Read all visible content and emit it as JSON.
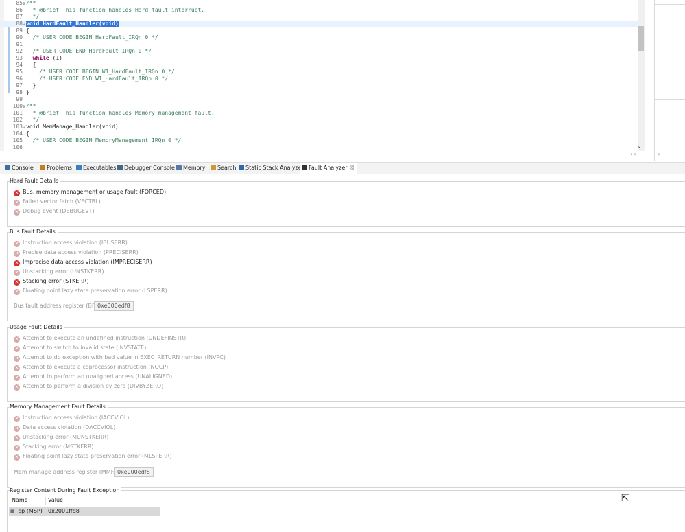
{
  "editor": {
    "lines": [
      {
        "n": "85",
        "fold": "⊖",
        "parts": [
          {
            "t": "/**",
            "c": "cmt"
          }
        ]
      },
      {
        "n": "86",
        "fold": "",
        "parts": [
          {
            "t": "  * @brief This function handles Hard fault interrupt.",
            "c": "cmt"
          }
        ]
      },
      {
        "n": "87",
        "fold": "",
        "parts": [
          {
            "t": "  */",
            "c": "cmt"
          }
        ]
      },
      {
        "n": "88",
        "fold": "⊖",
        "cur": true,
        "parts": [
          {
            "t": "void HardFault_Handler(void)",
            "c": "sel"
          }
        ]
      },
      {
        "n": "89",
        "fold": "",
        "parts": [
          {
            "t": "{",
            "c": "code"
          }
        ]
      },
      {
        "n": "90",
        "fold": "",
        "parts": [
          {
            "t": "  /* USER CODE BEGIN HardFault_IRQn 0 */",
            "c": "cmt"
          }
        ]
      },
      {
        "n": "91",
        "fold": "",
        "parts": [
          {
            "t": "",
            "c": "code"
          }
        ]
      },
      {
        "n": "92",
        "fold": "",
        "parts": [
          {
            "t": "  /* USER CODE END HardFault_IRQn 0 */",
            "c": "cmt"
          }
        ]
      },
      {
        "n": "93",
        "fold": "",
        "parts": [
          {
            "t": "  ",
            "c": "code"
          },
          {
            "t": "while",
            "c": "kw"
          },
          {
            "t": " (1)",
            "c": "code"
          }
        ]
      },
      {
        "n": "94",
        "fold": "",
        "parts": [
          {
            "t": "  {",
            "c": "code"
          }
        ]
      },
      {
        "n": "95",
        "fold": "",
        "parts": [
          {
            "t": "    /* USER CODE BEGIN W1_HardFault_IRQn 0 */",
            "c": "cmt"
          }
        ]
      },
      {
        "n": "96",
        "fold": "",
        "parts": [
          {
            "t": "    /* USER CODE END W1_HardFault_IRQn 0 */",
            "c": "cmt"
          }
        ]
      },
      {
        "n": "97",
        "fold": "",
        "parts": [
          {
            "t": "  }",
            "c": "code"
          }
        ]
      },
      {
        "n": "98",
        "fold": "",
        "parts": [
          {
            "t": "}",
            "c": "code"
          }
        ]
      },
      {
        "n": "99",
        "fold": "",
        "parts": [
          {
            "t": "",
            "c": "code"
          }
        ]
      },
      {
        "n": "100",
        "fold": "⊖",
        "parts": [
          {
            "t": "/**",
            "c": "cmt"
          }
        ]
      },
      {
        "n": "101",
        "fold": "",
        "parts": [
          {
            "t": "  * @brief This function handles Memory management fault.",
            "c": "cmt"
          }
        ]
      },
      {
        "n": "102",
        "fold": "",
        "parts": [
          {
            "t": "  */",
            "c": "cmt"
          }
        ]
      },
      {
        "n": "103",
        "fold": "⊖",
        "parts": [
          {
            "t": "void MemManage_Handler(void)",
            "c": "code"
          }
        ]
      },
      {
        "n": "104",
        "fold": "",
        "parts": [
          {
            "t": "{",
            "c": "code"
          }
        ]
      },
      {
        "n": "105",
        "fold": "",
        "parts": [
          {
            "t": "  /* USER CODE BEGIN MemoryManagement_IRQn 0 */",
            "c": "cmt"
          }
        ]
      },
      {
        "n": "106",
        "fold": "",
        "parts": [
          {
            "t": "",
            "c": "code"
          }
        ]
      }
    ]
  },
  "tabs": [
    {
      "label": "Console",
      "icon": "console-icon",
      "color": "#3a6ea5"
    },
    {
      "label": "Problems",
      "icon": "problems-icon",
      "color": "#c08020"
    },
    {
      "label": "Executables",
      "icon": "executables-icon",
      "color": "#3a7fc0"
    },
    {
      "label": "Debugger Console",
      "icon": "debugger-console-icon",
      "color": "#446688"
    },
    {
      "label": "Memory",
      "icon": "memory-icon",
      "color": "#5577aa"
    },
    {
      "label": "Search",
      "icon": "search-icon",
      "color": "#cc9933"
    },
    {
      "label": "Static Stack Analyzer",
      "icon": "stack-analyzer-icon",
      "color": "#3366aa"
    },
    {
      "label": "Fault Analyzer",
      "icon": "fault-analyzer-icon",
      "color": "#333333",
      "active": true,
      "close": "☒"
    }
  ],
  "hard_fault": {
    "title": "Hard Fault Details",
    "items": [
      {
        "label": "Bus, memory management or usage fault (FORCED)",
        "active": true
      },
      {
        "label": "Failed vector fetch (VECTBL)",
        "active": false
      },
      {
        "label": "Debug event (DEBUGEVT)",
        "active": false
      }
    ]
  },
  "bus_fault": {
    "title": "Bus Fault Details",
    "items": [
      {
        "label": "Instruction access violation (IBUSERR)",
        "active": false
      },
      {
        "label": "Precise data access violation (PRECISERR)",
        "active": false
      },
      {
        "label": "Imprecise data access violation (IMPRECISERR)",
        "active": true
      },
      {
        "label": "Unstacking error (UNSTKERR)",
        "active": false
      },
      {
        "label": "Stacking error (STKERR)",
        "active": true
      },
      {
        "label": "Floating point lazy state preservation error (LSPERR)",
        "active": false
      }
    ],
    "register_label": "Bus fault address register (BFAR):",
    "register_value": "0xe000edf8"
  },
  "usage_fault": {
    "title": "Usage Fault Details",
    "items": [
      {
        "label": "Attempt to execute an undefined instruction (UNDEFINSTR)",
        "active": false
      },
      {
        "label": "Attempt to switch to invalid state (INVSTATE)",
        "active": false
      },
      {
        "label": "Attempt to do exception with bad value in EXEC_RETURN number (INVPC)",
        "active": false
      },
      {
        "label": "Attempt to execute a coprocessor instruction (NOCP)",
        "active": false
      },
      {
        "label": "Attempt to perform an unaligned access (UNALIGNED)",
        "active": false
      },
      {
        "label": "Attempt to perform a division by zero (DIVBYZERO)",
        "active": false
      }
    ]
  },
  "mem_fault": {
    "title": "Memory Management Fault Details",
    "items": [
      {
        "label": "Instruction access violation (IACCVIOL)",
        "active": false
      },
      {
        "label": "Data access violation (DACCVIOL)",
        "active": false
      },
      {
        "label": "Unstacking error (MUNSTKERR)",
        "active": false
      },
      {
        "label": "Stacking error (MSTKERR)",
        "active": false
      },
      {
        "label": "Floating point lazy state preservation error (MLSPERR)",
        "active": false
      }
    ],
    "register_label": "Mem manage address register (MMFAR):",
    "register_value": "0xe000edf8"
  },
  "register_content": {
    "title": "Register Content During Fault Exception",
    "col_name": "Name",
    "col_value": "Value",
    "rows": [
      {
        "name": "sp (MSP)",
        "value": "0x2001ffd8",
        "icon": "register-icon"
      }
    ]
  },
  "icons": {
    "error": "✕"
  }
}
